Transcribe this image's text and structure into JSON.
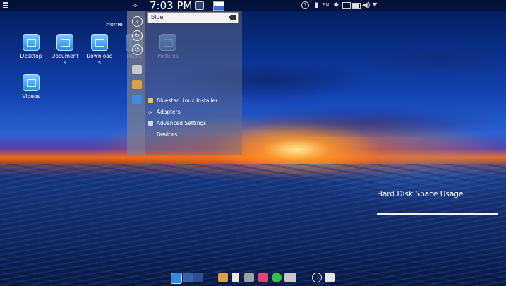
{
  "topbar": {
    "clock": "7:03 PM",
    "language": "EN",
    "icons": [
      "menu-icon",
      "launcher-icon",
      "window-icon",
      "flag-icon",
      "help-icon",
      "usb-icon",
      "lang-icon",
      "gear-icon",
      "display-icon",
      "battery-icon",
      "volume-icon",
      "chevron-down-icon"
    ]
  },
  "desktop": {
    "home_label": "Home",
    "icons": [
      {
        "label": "Desktop"
      },
      {
        "label": "Document s"
      },
      {
        "label": "Download s"
      },
      {
        "label": "Music"
      },
      {
        "label": "Pictures"
      },
      {
        "label": "Videos"
      }
    ]
  },
  "launcher": {
    "search_value": "blue",
    "results": [
      {
        "label": "Bluestar Linux Installer"
      },
      {
        "label": "Adapters"
      },
      {
        "label": "Advanced Settings"
      },
      {
        "label": "Devices"
      }
    ]
  },
  "widget": {
    "title": "Hard Disk Space Usage",
    "used_fraction": 1.0
  },
  "dock": {
    "items": [
      "desktop-app-icon",
      "workspace-switcher-icon",
      "files-icon",
      "phone-icon",
      "film-icon",
      "music-icon",
      "whatsapp-icon",
      "hard-disk-icon",
      "power-icon",
      "package-icon"
    ]
  },
  "colors": {
    "accent": "#2a8de0",
    "panel": "#6e6e82"
  }
}
